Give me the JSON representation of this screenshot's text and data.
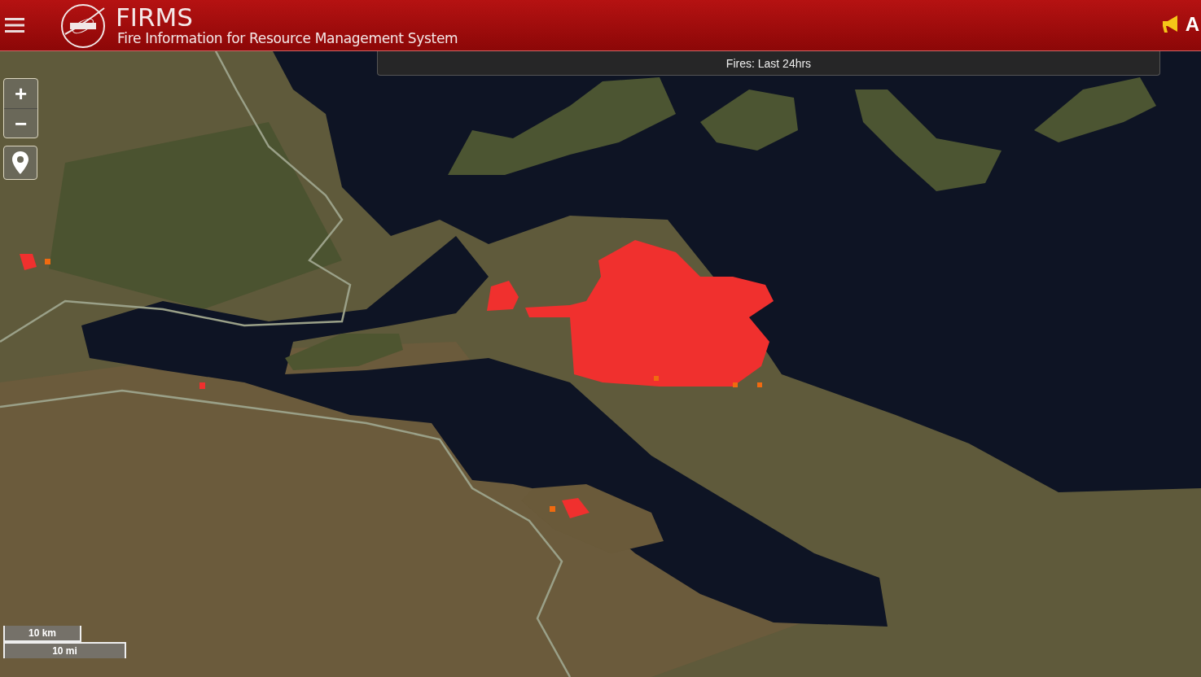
{
  "header": {
    "title": "FIRMS",
    "subtitle": "Fire Information for Resource Management System",
    "right_label": "A"
  },
  "map": {
    "layer_banner": "Fires: Last 24hrs",
    "zoom_in": "+",
    "zoom_out": "−",
    "scale_km": "10 km",
    "scale_mi": "10 mi"
  }
}
